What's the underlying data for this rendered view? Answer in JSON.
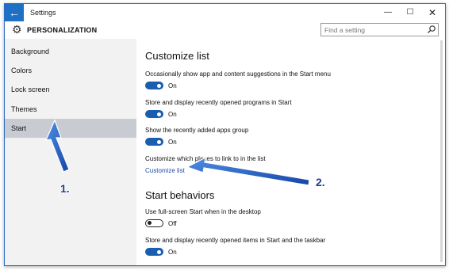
{
  "window": {
    "title": "Settings",
    "back_icon": "arrow-left-icon",
    "minimize": "—",
    "maximize": "☐",
    "close": "✕"
  },
  "header": {
    "icon": "gear-icon",
    "section_title": "PERSONALIZATION",
    "search_placeholder": "Find a setting"
  },
  "sidebar": {
    "items": [
      {
        "label": "Background",
        "selected": false
      },
      {
        "label": "Colors",
        "selected": false
      },
      {
        "label": "Lock screen",
        "selected": false
      },
      {
        "label": "Themes",
        "selected": false
      },
      {
        "label": "Start",
        "selected": true
      }
    ]
  },
  "main": {
    "customize_heading": "Customize list",
    "settings": [
      {
        "label": "Occasionally show app and content suggestions in the Start menu",
        "state": "On"
      },
      {
        "label": "Store and display recently opened programs in Start",
        "state": "On"
      },
      {
        "label": "Show the recently added apps group",
        "state": "On"
      }
    ],
    "places_label": "Customize which places to link to in the list",
    "customize_link": "Customize list",
    "start_heading": "Start behaviors",
    "behaviors": [
      {
        "label": "Use full-screen Start when in the desktop",
        "state": "Off"
      },
      {
        "label": "Store and display recently opened items in Start and the taskbar",
        "state": "On"
      }
    ]
  },
  "annotations": {
    "one": "1.",
    "two": "2."
  },
  "colors": {
    "accent": "#1a5eb0",
    "selected_nav": "#c8ccd2",
    "sidebar_bg": "#f2f2f2",
    "arrow": "#1f5cc0"
  }
}
